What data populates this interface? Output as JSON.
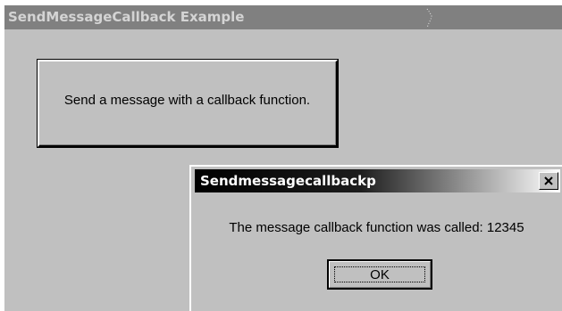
{
  "main_window": {
    "title": "SendMessageCallback Example",
    "send_button_label": "Send a message with a callback function."
  },
  "message_box": {
    "title": "Sendmessagecallbackp",
    "message": "The message callback function was called: 12345",
    "ok_label": "OK",
    "close_icon": "close-icon"
  },
  "colors": {
    "window_face": "#c0c0c0",
    "inactive_titlebar": "#808080",
    "inactive_title_text": "#d4d4d4",
    "active_titlebar_start": "#000000",
    "active_titlebar_end": "#ffffff"
  }
}
